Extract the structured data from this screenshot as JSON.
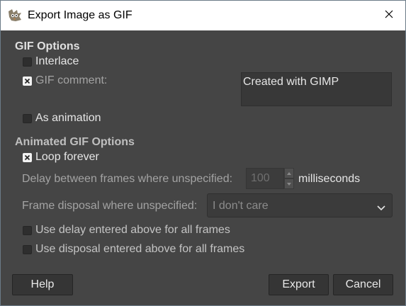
{
  "window": {
    "title": "Export Image as GIF"
  },
  "gif_options": {
    "heading": "GIF Options",
    "interlace": {
      "label": "Interlace",
      "checked": false
    },
    "gif_comment": {
      "label": "GIF comment:",
      "checked": true,
      "value": "Created with GIMP"
    },
    "as_animation": {
      "label": "As animation",
      "checked": false
    }
  },
  "animated_options": {
    "heading": "Animated GIF Options",
    "loop_forever": {
      "label": "Loop forever",
      "checked": true
    },
    "delay": {
      "label": "Delay between frames where unspecified:",
      "value": "100",
      "unit": "milliseconds"
    },
    "disposal": {
      "label": "Frame disposal where unspecified:",
      "selected": "I don't care"
    },
    "use_delay": {
      "label": "Use delay entered above for all frames",
      "checked": false
    },
    "use_disposal": {
      "label": "Use disposal entered above for all frames",
      "checked": false
    }
  },
  "buttons": {
    "help": "Help",
    "export": "Export",
    "cancel": "Cancel"
  },
  "icons": {
    "app": "gimp-wilber-icon",
    "close": "close-icon",
    "check": "check-icon",
    "dropdown": "chevron-down-icon"
  }
}
